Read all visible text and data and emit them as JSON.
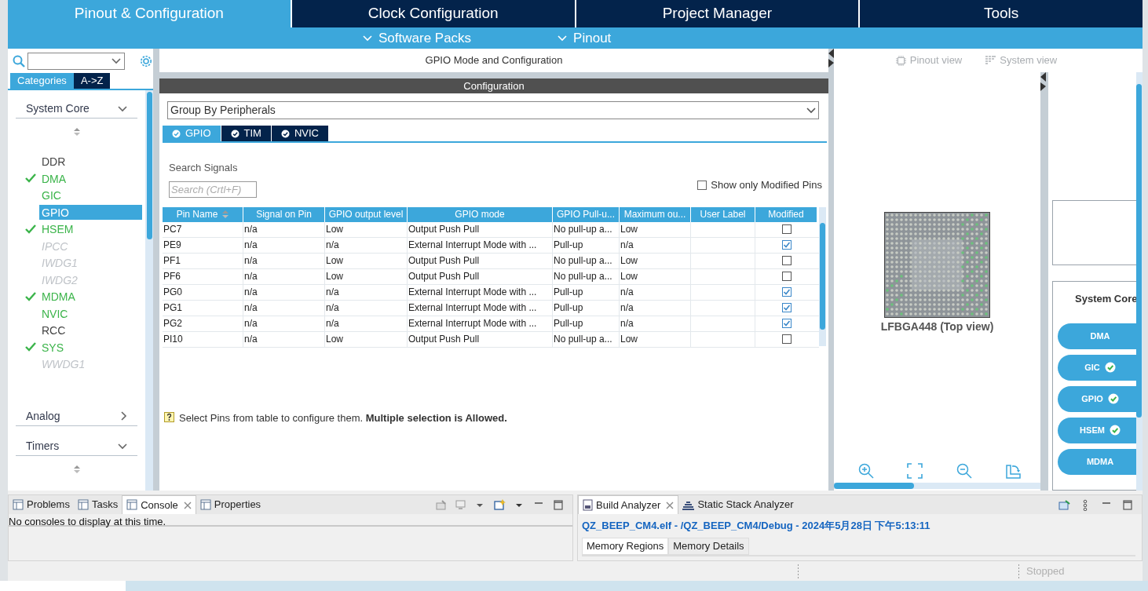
{
  "top_tabs": [
    {
      "label": "Pinout & Configuration",
      "selected": true
    },
    {
      "label": "Clock Configuration",
      "selected": false
    },
    {
      "label": "Project Manager",
      "selected": false
    },
    {
      "label": "Tools",
      "selected": false
    }
  ],
  "sub_menus": [
    "Software Packs",
    "Pinout"
  ],
  "sidebar": {
    "view_tabs": [
      {
        "label": "Categories",
        "selected": true
      },
      {
        "label": "A->Z",
        "selected": false
      }
    ],
    "categories": [
      {
        "label": "System Core",
        "expanded": true,
        "items": [
          {
            "label": "DDR",
            "kind": "plain",
            "checked": false,
            "selected": false
          },
          {
            "label": "DMA",
            "kind": "available",
            "checked": true,
            "selected": false
          },
          {
            "label": "GIC",
            "kind": "available",
            "checked": false,
            "selected": false
          },
          {
            "label": "GPIO",
            "kind": "available",
            "checked": false,
            "selected": true
          },
          {
            "label": "HSEM",
            "kind": "available",
            "checked": true,
            "selected": false
          },
          {
            "label": "IPCC",
            "kind": "unavailable",
            "checked": false,
            "selected": false
          },
          {
            "label": "IWDG1",
            "kind": "unavailable",
            "checked": false,
            "selected": false
          },
          {
            "label": "IWDG2",
            "kind": "unavailable",
            "checked": false,
            "selected": false
          },
          {
            "label": "MDMA",
            "kind": "available",
            "checked": true,
            "selected": false
          },
          {
            "label": "NVIC",
            "kind": "available",
            "checked": false,
            "selected": false
          },
          {
            "label": "RCC",
            "kind": "plain",
            "checked": false,
            "selected": false
          },
          {
            "label": "SYS",
            "kind": "available",
            "checked": true,
            "selected": false
          },
          {
            "label": "WWDG1",
            "kind": "unavailable",
            "checked": false,
            "selected": false
          }
        ]
      },
      {
        "label": "Analog",
        "expanded": false
      },
      {
        "label": "Timers",
        "expanded": true
      }
    ]
  },
  "config": {
    "title": "GPIO Mode and Configuration",
    "header": "Configuration",
    "group_by": "Group By Peripherals",
    "tabs": [
      {
        "label": "GPIO",
        "selected": true
      },
      {
        "label": "TIM",
        "selected": false
      },
      {
        "label": "NVIC",
        "selected": false
      }
    ],
    "search_label": "Search Signals",
    "search_placeholder": "Search (Crtl+F)",
    "show_modified": {
      "label": "Show only Modified Pins",
      "checked": false
    },
    "table": {
      "columns": [
        {
          "label": "Pin Name",
          "sortable": true
        },
        {
          "label": "Signal on Pin",
          "sortable": false
        },
        {
          "label": "GPIO output level",
          "sortable": false
        },
        {
          "label": "GPIO mode",
          "sortable": false
        },
        {
          "label": "GPIO Pull-u...",
          "sortable": false
        },
        {
          "label": "Maximum ou...",
          "sortable": false
        },
        {
          "label": "User Label",
          "sortable": false
        },
        {
          "label": "Modified",
          "sortable": false
        }
      ],
      "rows": [
        {
          "cells": [
            "PC7",
            "n/a",
            "Low",
            "Output Push Pull",
            "No pull-up a...",
            "Low",
            ""
          ],
          "modified": false
        },
        {
          "cells": [
            "PE9",
            "n/a",
            "n/a",
            "External Interrupt Mode with ...",
            "Pull-up",
            "n/a",
            ""
          ],
          "modified": true
        },
        {
          "cells": [
            "PF1",
            "n/a",
            "Low",
            "Output Push Pull",
            "No pull-up a...",
            "Low",
            ""
          ],
          "modified": false
        },
        {
          "cells": [
            "PF6",
            "n/a",
            "Low",
            "Output Push Pull",
            "No pull-up a...",
            "Low",
            ""
          ],
          "modified": false
        },
        {
          "cells": [
            "PG0",
            "n/a",
            "n/a",
            "External Interrupt Mode with ...",
            "Pull-up",
            "n/a",
            ""
          ],
          "modified": true
        },
        {
          "cells": [
            "PG1",
            "n/a",
            "n/a",
            "External Interrupt Mode with ...",
            "Pull-up",
            "n/a",
            ""
          ],
          "modified": true
        },
        {
          "cells": [
            "PG2",
            "n/a",
            "n/a",
            "External Interrupt Mode with ...",
            "Pull-up",
            "n/a",
            ""
          ],
          "modified": true
        },
        {
          "cells": [
            "PI10",
            "n/a",
            "Low",
            "Output Push Pull",
            "No pull-up a...",
            "Low",
            ""
          ],
          "modified": false
        }
      ]
    },
    "hint": "Select Pins from table to configure them. **Multiple selection is Allowed.**"
  },
  "pinout": {
    "view_tabs": [
      "Pinout view",
      "System view"
    ],
    "chip_label": "LFBGA448 (Top view)",
    "system_title": "System Core",
    "system_buttons": [
      {
        "label": "DMA",
        "checked": false
      },
      {
        "label": "GIC",
        "checked": true
      },
      {
        "label": "GPIO",
        "checked": true
      },
      {
        "label": "HSEM",
        "checked": true
      },
      {
        "label": "MDMA",
        "checked": false
      }
    ]
  },
  "console": {
    "tabs": [
      {
        "label": "Problems",
        "selected": false,
        "closable": false
      },
      {
        "label": "Tasks",
        "selected": false,
        "closable": false
      },
      {
        "label": "Console",
        "selected": true,
        "closable": true
      },
      {
        "label": "Properties",
        "selected": false,
        "closable": false
      }
    ],
    "message": "No consoles to display at this time."
  },
  "analyzer": {
    "tabs": [
      {
        "label": "Build Analyzer",
        "selected": true,
        "closable": true
      },
      {
        "label": "Static Stack Analyzer",
        "selected": false,
        "closable": false
      }
    ],
    "path": "QZ_BEEP_CM4.elf - /QZ_BEEP_CM4/Debug - 2024年5月28日 下午5:13:11",
    "sub_tabs": [
      {
        "label": "Memory Regions",
        "selected": true
      },
      {
        "label": "Memory Details",
        "selected": false
      }
    ]
  },
  "status_bar": {
    "text": "Stopped"
  }
}
